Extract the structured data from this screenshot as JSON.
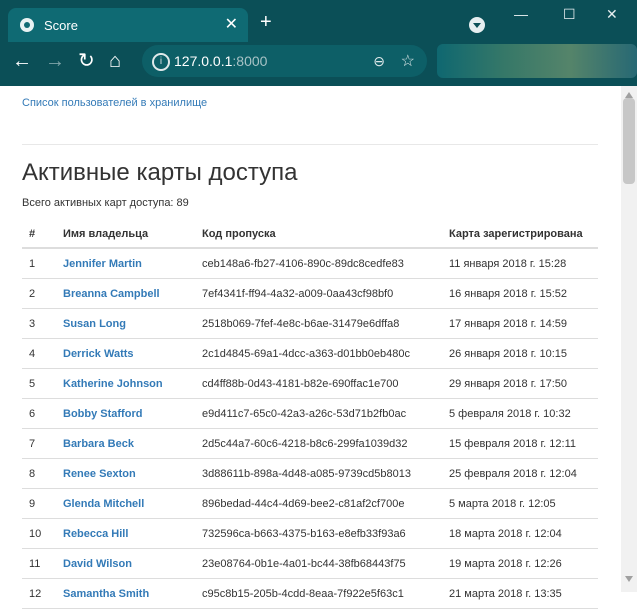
{
  "browser": {
    "tab_title": "Score",
    "address": {
      "host": "127.0.0.1",
      "port": ":8000"
    }
  },
  "page": {
    "top_link": "Список пользователей в хранилище",
    "title": "Активные карты доступа",
    "total_label": "Всего активных карт доступа:",
    "total_count": "89",
    "columns": [
      "#",
      "Имя владельца",
      "Код пропуска",
      "Карта зарегистрирована"
    ],
    "rows": [
      {
        "n": "1",
        "name": "Jennifer Martin",
        "code": "ceb148a6-fb27-4106-890c-89dc8cedfe83",
        "date": "11 января 2018 г. 15:28"
      },
      {
        "n": "2",
        "name": "Breanna Campbell",
        "code": "7ef4341f-ff94-4a32-a009-0aa43cf98bf0",
        "date": "16 января 2018 г. 15:52"
      },
      {
        "n": "3",
        "name": "Susan Long",
        "code": "2518b069-7fef-4e8c-b6ae-31479e6dffa8",
        "date": "17 января 2018 г. 14:59"
      },
      {
        "n": "4",
        "name": "Derrick Watts",
        "code": "2c1d4845-69a1-4dcc-a363-d01bb0eb480c",
        "date": "26 января 2018 г. 10:15"
      },
      {
        "n": "5",
        "name": "Katherine Johnson",
        "code": "cd4ff88b-0d43-4181-b82e-690ffac1e700",
        "date": "29 января 2018 г. 17:50"
      },
      {
        "n": "6",
        "name": "Bobby Stafford",
        "code": "e9d411c7-65c0-42a3-a26c-53d71b2fb0ac",
        "date": "5 февраля 2018 г. 10:32"
      },
      {
        "n": "7",
        "name": "Barbara Beck",
        "code": "2d5c44a7-60c6-4218-b8c6-299fa1039d32",
        "date": "15 февраля 2018 г. 12:11"
      },
      {
        "n": "8",
        "name": "Renee Sexton",
        "code": "3d88611b-898a-4d48-a085-9739cd5b8013",
        "date": "25 февраля 2018 г. 12:04"
      },
      {
        "n": "9",
        "name": "Glenda Mitchell",
        "code": "896bedad-44c4-4d69-bee2-c81af2cf700e",
        "date": "5 марта 2018 г. 12:05"
      },
      {
        "n": "10",
        "name": "Rebecca Hill",
        "code": "732596ca-b663-4375-b163-e8efb33f93a6",
        "date": "18 марта 2018 г. 12:04"
      },
      {
        "n": "11",
        "name": "David Wilson",
        "code": "23e08764-0b1e-4a01-bc44-38fb68443f75",
        "date": "19 марта 2018 г. 12:26"
      },
      {
        "n": "12",
        "name": "Samantha Smith",
        "code": "c95c8b15-205b-4cdd-8eaa-7f922e5f63c1",
        "date": "21 марта 2018 г. 13:35"
      }
    ]
  }
}
